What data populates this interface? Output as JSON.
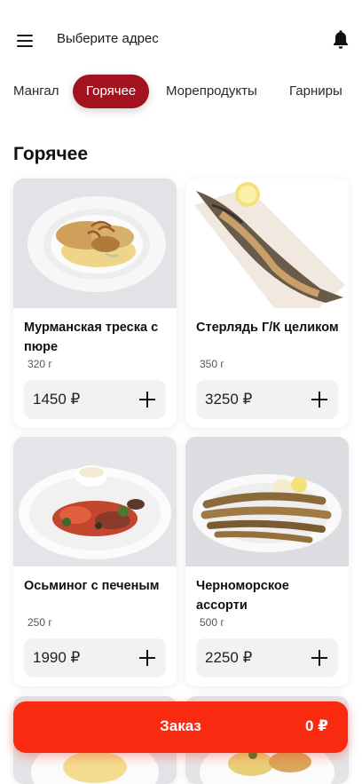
{
  "header": {
    "address_label": "Выберите адрес"
  },
  "categories": [
    {
      "label": "Мангал",
      "active": false
    },
    {
      "label": "Горячее",
      "active": true
    },
    {
      "label": "Морепродукты",
      "active": false
    },
    {
      "label": "Гарниры",
      "active": false
    }
  ],
  "section": {
    "title": "Горячее"
  },
  "products": [
    {
      "name": "Мурманская треска с пюре",
      "weight": "320 г",
      "price": "1450 ₽",
      "image": "cod-with-puree"
    },
    {
      "name": "Стерлядь Г/К целиком",
      "weight": "350 г",
      "price": "3250 ₽",
      "image": "smoked-sterlet"
    },
    {
      "name": "Осьминог с печеным",
      "weight": "250 г",
      "price": "1990 ₽",
      "image": "octopus-salad"
    },
    {
      "name": "Черноморское ассорти",
      "weight": "500 г",
      "price": "2250 ₽",
      "image": "fried-fish-assortment"
    }
  ],
  "order_bar": {
    "label": "Заказ",
    "total": "0 ₽"
  },
  "colors": {
    "active_tab": "#a3131f",
    "order_button": "#fa2a10",
    "price_pill": "#f2f2f2"
  },
  "icons": {
    "menu": "menu-icon",
    "notifications": "bell-icon",
    "add": "plus-icon"
  }
}
